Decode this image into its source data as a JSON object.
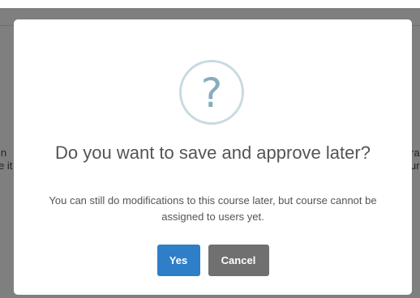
{
  "background": {
    "left_fragment": "in\ne it",
    "right_fragment": "ra\nur"
  },
  "dialog": {
    "icon": "question-mark-icon",
    "icon_glyph": "?",
    "title": "Do you want to save and approve later?",
    "message": "You can still do modifications to this course later, but course cannot be assigned to users yet.",
    "confirm_label": "Yes",
    "cancel_label": "Cancel"
  },
  "colors": {
    "confirm": "#2e7fc8",
    "cancel": "#707070",
    "icon_ring": "#c9dae1",
    "icon_glyph": "#87adbd",
    "overlay": "#7f7f7f"
  }
}
